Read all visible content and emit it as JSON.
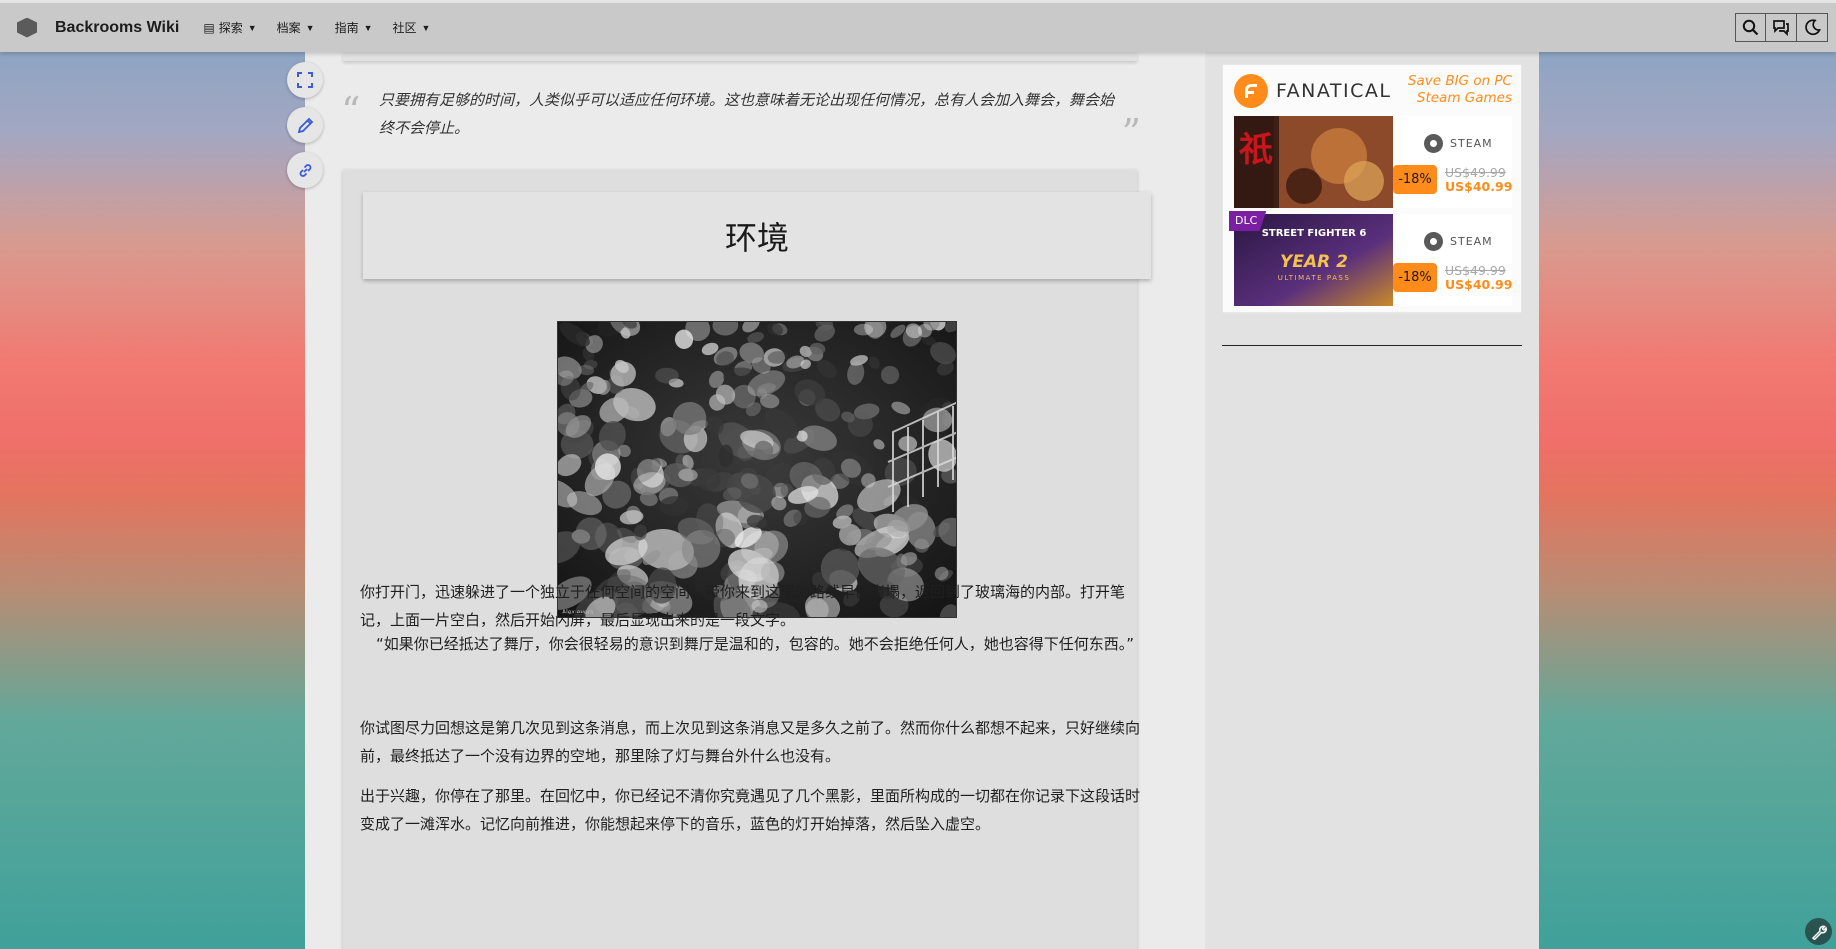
{
  "header": {
    "site_title": "Backrooms Wiki",
    "nav": [
      {
        "label": "探索",
        "icon": "book-icon"
      },
      {
        "label": "档案"
      },
      {
        "label": "指南"
      },
      {
        "label": "社区"
      }
    ],
    "actions": [
      "search-icon",
      "chat-icon",
      "moon-icon"
    ]
  },
  "article": {
    "epigraph": "只要拥有足够的时间，人类似乎可以适应任何环境。这也意味着无论出现任何情况，总有人会加入舞会，舞会始终不会停止。",
    "section_title": "环境",
    "image": {
      "description_icon": "crowd-photo",
      "credit": "Alex evers"
    },
    "paragraphs": [
      "你打开门，迅速躲进了一个独立于任何空间的空间。带你来到这里的路线早已崩塌，返回到了玻璃海的内部。打开笔记，上面一片空白，然后开始闪屏，最后显现出来的是一段文字。",
      "“如果你已经抵达了舞厅，你会很轻易的意识到舞厅是温和的，包容的。她不会拒绝任何人，她也容得下任何东西。”",
      "你试图尽力回想这是第几次见到这条消息，而上次见到这条消息又是多久之前了。然而你什么都想不起来，只好继续向前，最终抵达了一个没有边界的空地，那里除了灯与舞台外什么也没有。",
      "出于兴趣，你停在了那里。在回忆中，你已经记不清你究竟遇见了几个黑影，里面所构成的一切都在你记录下这段话时变成了一滩浑水。记忆向前推进，你能想起来停下的音乐，蓝色的灯开始掉落，然后坠入虚空。"
    ]
  },
  "ad": {
    "brand": "FANATICAL",
    "tagline_1": "Save BIG on PC",
    "tagline_2": "Steam Games",
    "accent": "#ff8c1a",
    "deals": [
      {
        "store": "STEAM",
        "discount": "-18%",
        "old_price": "US$49.99",
        "new_price": "US$40.99"
      },
      {
        "store": "STEAM",
        "discount": "-18%",
        "old_price": "US$49.99",
        "new_price": "US$40.99",
        "badge": "DLC",
        "art_title_1": "STREET FIGHTER 6",
        "art_title_2": "YEAR 2",
        "art_title_3": "ULTIMATE PASS"
      }
    ]
  }
}
